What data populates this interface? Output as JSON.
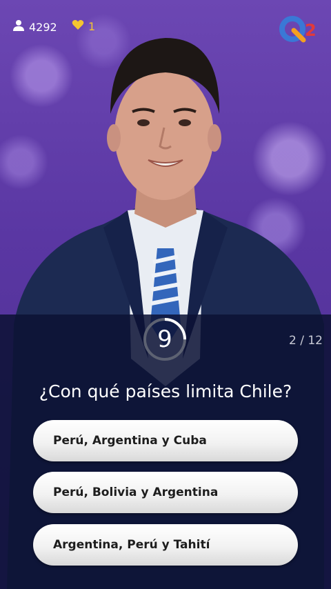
{
  "header": {
    "player_count": "4292",
    "lives_count": "1",
    "player_icon": "person-icon",
    "lives_icon": "heart-icon",
    "logo": "q12-logo"
  },
  "question": {
    "timer": "9",
    "timer_remaining_fraction": 0.25,
    "progress": "2 / 12",
    "text": "¿Con qué países limita Chile?"
  },
  "answers": [
    {
      "label": "Perú, Argentina y Cuba"
    },
    {
      "label": "Perú, Bolivia y Argentina"
    },
    {
      "label": "Argentina, Perú y Tahití"
    }
  ],
  "colors": {
    "background": "#5a37a3",
    "panel": "#0c1234",
    "lives": "#f4c531",
    "logo_blue": "#3a78d6",
    "logo_orange": "#f4a020",
    "logo_red": "#e23a3a"
  }
}
